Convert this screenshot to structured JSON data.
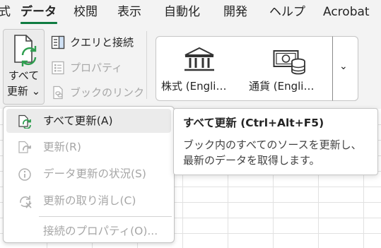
{
  "ribbon_tabs": [
    {
      "label": "式",
      "active": false
    },
    {
      "label": "データ",
      "active": true
    },
    {
      "label": "校閲",
      "active": false
    },
    {
      "label": "表示",
      "active": false
    },
    {
      "label": "自動化",
      "active": false
    },
    {
      "label": "開発",
      "active": false
    },
    {
      "label": "ヘルプ",
      "active": false
    },
    {
      "label": "Acrobat",
      "active": false
    }
  ],
  "refresh_all": {
    "line1": "すべて",
    "line2": "更新 ⌄"
  },
  "queries_group": [
    {
      "label": "クエリと接続",
      "enabled": true,
      "icon": "queries-connections-icon"
    },
    {
      "label": "プロパティ",
      "enabled": false,
      "icon": "properties-icon"
    },
    {
      "label": "ブックのリンク",
      "enabled": false,
      "icon": "workbook-links-icon"
    }
  ],
  "data_types": [
    {
      "label": "株式 (Engli…",
      "icon": "stocks-bank-icon"
    },
    {
      "label": "通貨 (Engli…",
      "icon": "currency-icon"
    }
  ],
  "gallery_more": "⌄",
  "menu": {
    "items": [
      {
        "label": "すべて更新(A)",
        "enabled": true,
        "icon": "refresh-all-icon"
      },
      {
        "label": "更新(R)",
        "enabled": false,
        "icon": "refresh-icon"
      },
      {
        "label": "データ更新の状況(S)",
        "enabled": false,
        "icon": "info-icon"
      },
      {
        "label": "更新の取り消し(C)",
        "enabled": false,
        "icon": "cancel-refresh-icon"
      },
      {
        "label": "接続のプロパティ(O)...",
        "enabled": false,
        "icon": ""
      }
    ]
  },
  "tooltip": {
    "title": "すべて更新 (Ctrl+Alt+F5)",
    "line1": "ブック内のすべてのソースを更新し、",
    "line2": "最新のデータを取得します。"
  },
  "colors": {
    "accent": "#107c41",
    "disabled": "#a6a6a6",
    "refresh_arrow": "#2e9e4f"
  }
}
